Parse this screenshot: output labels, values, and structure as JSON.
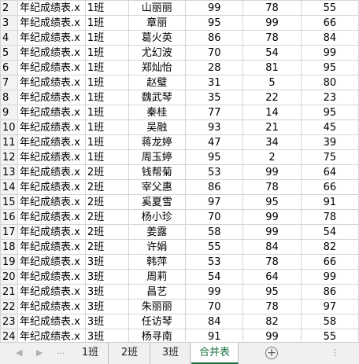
{
  "rows": [
    {
      "row": "2",
      "source": "年纪成绩表.x",
      "cls": "1班",
      "name": "山丽丽",
      "s1": "99",
      "s2": "78",
      "s3": "55"
    },
    {
      "row": "3",
      "source": "年纪成绩表.x",
      "cls": "1班",
      "name": "章丽",
      "s1": "95",
      "s2": "99",
      "s3": "66"
    },
    {
      "row": "4",
      "source": "年纪成绩表.x",
      "cls": "1班",
      "name": "葛火英",
      "s1": "86",
      "s2": "78",
      "s3": "84"
    },
    {
      "row": "5",
      "source": "年纪成绩表.x",
      "cls": "1班",
      "name": "尤幻波",
      "s1": "70",
      "s2": "54",
      "s3": "99"
    },
    {
      "row": "6",
      "source": "年纪成绩表.x",
      "cls": "1班",
      "name": "郑灿怡",
      "s1": "28",
      "s2": "81",
      "s3": "95"
    },
    {
      "row": "7",
      "source": "年纪成绩表.x",
      "cls": "1班",
      "name": "赵璧",
      "s1": "31",
      "s2": "5",
      "s3": "80"
    },
    {
      "row": "8",
      "source": "年纪成绩表.x",
      "cls": "1班",
      "name": "魏武琴",
      "s1": "35",
      "s2": "22",
      "s3": "23"
    },
    {
      "row": "9",
      "source": "年纪成绩表.x",
      "cls": "1班",
      "name": "秦桂",
      "s1": "77",
      "s2": "14",
      "s3": "95"
    },
    {
      "row": "10",
      "source": "年纪成绩表.x",
      "cls": "1班",
      "name": "吴融",
      "s1": "93",
      "s2": "21",
      "s3": "45"
    },
    {
      "row": "11",
      "source": "年纪成绩表.x",
      "cls": "1班",
      "name": "蒋龙婷",
      "s1": "47",
      "s2": "34",
      "s3": "39"
    },
    {
      "row": "12",
      "source": "年纪成绩表.x",
      "cls": "1班",
      "name": "周玉婷",
      "s1": "95",
      "s2": "2",
      "s3": "75"
    },
    {
      "row": "13",
      "source": "年纪成绩表.x",
      "cls": "2班",
      "name": "钱帮菊",
      "s1": "53",
      "s2": "99",
      "s3": "64"
    },
    {
      "row": "14",
      "source": "年纪成绩表.x",
      "cls": "2班",
      "name": "宰父惠",
      "s1": "86",
      "s2": "78",
      "s3": "66"
    },
    {
      "row": "15",
      "source": "年纪成绩表.x",
      "cls": "2班",
      "name": "奚夏雪",
      "s1": "97",
      "s2": "95",
      "s3": "91"
    },
    {
      "row": "16",
      "source": "年纪成绩表.x",
      "cls": "2班",
      "name": "杨小珍",
      "s1": "70",
      "s2": "99",
      "s3": "78"
    },
    {
      "row": "17",
      "source": "年纪成绩表.x",
      "cls": "2班",
      "name": "姜露",
      "s1": "58",
      "s2": "99",
      "s3": "54"
    },
    {
      "row": "18",
      "source": "年纪成绩表.x",
      "cls": "2班",
      "name": "许娟",
      "s1": "55",
      "s2": "84",
      "s3": "82"
    },
    {
      "row": "19",
      "source": "年纪成绩表.x",
      "cls": "3班",
      "name": "韩萍",
      "s1": "53",
      "s2": "78",
      "s3": "66"
    },
    {
      "row": "20",
      "source": "年纪成绩表.x",
      "cls": "3班",
      "name": "周莉",
      "s1": "54",
      "s2": "64",
      "s3": "99"
    },
    {
      "row": "21",
      "source": "年纪成绩表.x",
      "cls": "3班",
      "name": "昌艺",
      "s1": "99",
      "s2": "95",
      "s3": "86"
    },
    {
      "row": "22",
      "source": "年纪成绩表.x",
      "cls": "3班",
      "name": "朱丽丽",
      "s1": "70",
      "s2": "78",
      "s3": "97"
    },
    {
      "row": "23",
      "source": "年纪成绩表.x",
      "cls": "3班",
      "name": "任访琴",
      "s1": "84",
      "s2": "82",
      "s3": "58"
    },
    {
      "row": "24",
      "source": "年纪成绩表.x",
      "cls": "3班",
      "name": "杨寻南",
      "s1": "91",
      "s2": "99",
      "s3": "55"
    }
  ],
  "tabs": [
    {
      "label": "1班",
      "active": false
    },
    {
      "label": "2班",
      "active": false
    },
    {
      "label": "3班",
      "active": false
    },
    {
      "label": "合并表",
      "active": true
    }
  ],
  "nav": {
    "prev_icon": "triangle-left-icon",
    "next_icon": "triangle-right-icon",
    "more": "...",
    "add_icon": "plus-circle-icon",
    "add": "+",
    "separator": "⋮"
  },
  "colors": {
    "active_tab": "#1e7145",
    "grid": "#d4d4d4",
    "header_bg": "#f3f3f3"
  }
}
